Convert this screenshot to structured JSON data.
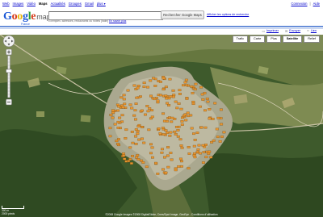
{
  "topnav": {
    "items": [
      "Web",
      "Images",
      "Vidéo",
      "Maps",
      "Actualités",
      "Groupes",
      "Gmail",
      "plus ▾"
    ],
    "active_index": 3,
    "right": [
      "Connexion",
      "Aide"
    ]
  },
  "logo": {
    "google": "Google",
    "maps": "maps",
    "country": "France"
  },
  "search": {
    "value": "",
    "button_label": "Rechercher Google Maps",
    "options_label": "Afficher les options de recherche",
    "hint_text": "Exemples :adresses, restaurants ou hôtels [Italie]",
    "hint_link": "En savoir plus"
  },
  "map_toolbar": {
    "print": "Imprimer",
    "send": "Envoyer",
    "link": "Lien"
  },
  "map_types": {
    "buttons": [
      "Trafic",
      "Carte",
      "Plus",
      "Satellite",
      "Relief"
    ],
    "selected": "Satellite"
  },
  "map": {
    "scale_label": "300 m",
    "scale_label_2": "2000 pieds",
    "copyright": "©2008 Google Images ©2008 DigitalGlobe, Cnes/Spot Image, GeoEye - Conditions d'utilisation",
    "colors": {
      "forest": "#3d5a2a",
      "field": "#8a9a62",
      "town": "#b6b29c",
      "marker": "#e8952e"
    }
  }
}
